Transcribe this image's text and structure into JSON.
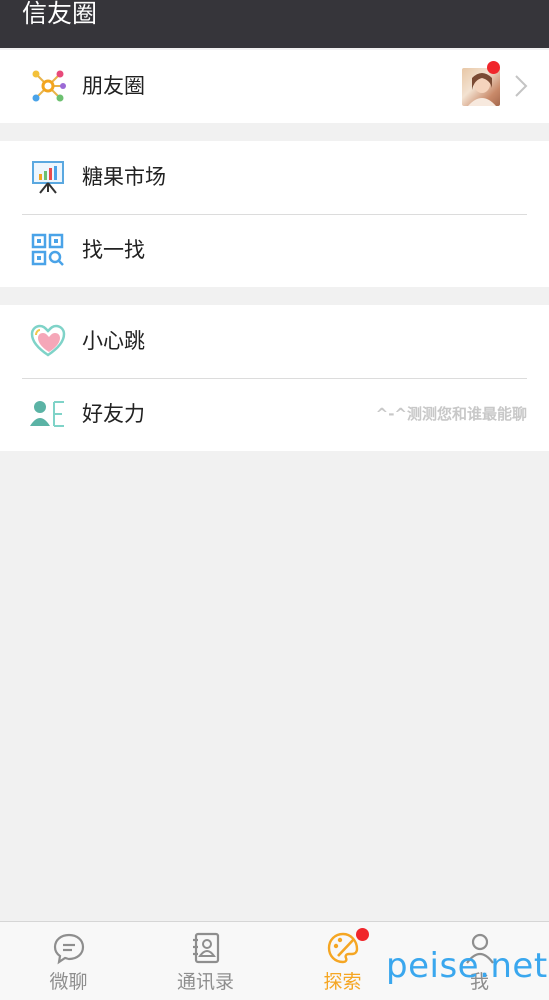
{
  "header": {
    "title": "信友圈"
  },
  "moments": {
    "label": "朋友圈"
  },
  "discover": {
    "market_label": "糖果市场",
    "find_label": "找一找"
  },
  "social": {
    "heartbeat_label": "小心跳",
    "friendship_label": "好友力",
    "friendship_hint": "^-^测测您和谁最能聊"
  },
  "tabbar": {
    "tabs": [
      {
        "label": "微聊",
        "icon": "chat-bubble-icon"
      },
      {
        "label": "通讯录",
        "icon": "contacts-book-icon"
      },
      {
        "label": "探索",
        "icon": "explore-palette-icon",
        "active": true
      },
      {
        "label": "我",
        "icon": "person-icon"
      }
    ]
  },
  "watermark": "peise.net",
  "colors": {
    "header_bg": "#36353a",
    "accent": "#f5a623",
    "badge": "#f0262b",
    "watermark": "#3aa7ee"
  }
}
